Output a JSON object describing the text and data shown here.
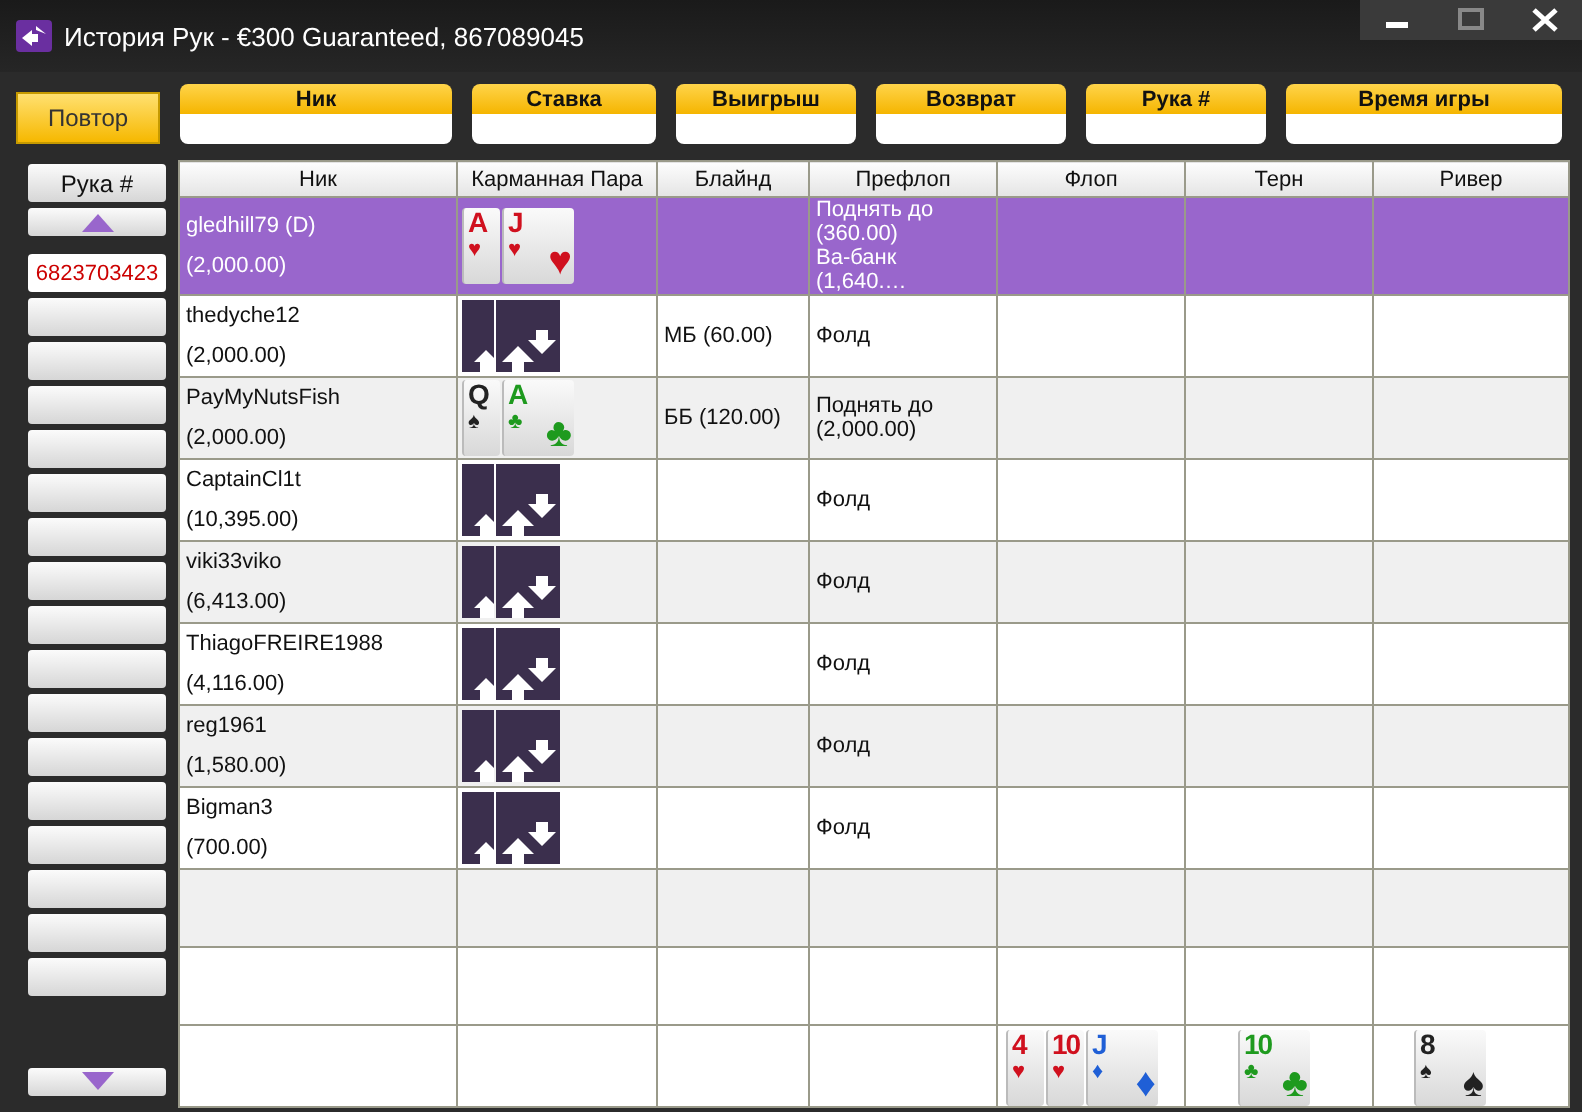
{
  "window": {
    "title": "История Рук - €300 Guaranteed, 867089045"
  },
  "replay_button": {
    "label": "Повтор"
  },
  "filters": [
    {
      "label": "Ник"
    },
    {
      "label": "Ставка"
    },
    {
      "label": "Выигрыш"
    },
    {
      "label": "Возврат"
    },
    {
      "label": "Рука #"
    },
    {
      "label": "Время игры"
    }
  ],
  "hand_list": {
    "header": "Рука #",
    "items": [
      {
        "number": "6823703423"
      }
    ]
  },
  "table": {
    "columns": [
      "Ник",
      "Карманная Пара",
      "Блайнд",
      "Префлоп",
      "Флоп",
      "Терн",
      "Ривер"
    ],
    "rows": [
      {
        "name": "gledhill79 (D)",
        "stack": "(2,000.00)",
        "selected": true,
        "cards": [
          {
            "kind": "face",
            "rank": "A",
            "corner_suit": "♥",
            "color": "#d0101e"
          },
          {
            "kind": "face",
            "rank": "J",
            "corner_suit": "♥",
            "center_suit": "♥",
            "color": "#d0101e"
          }
        ],
        "blind": "",
        "preflop": [
          "Поднять до",
          "(360.00)",
          "Ва-банк (1,640.…"
        ]
      },
      {
        "name": "thedyche12",
        "stack": "(2,000.00)",
        "selected": false,
        "cards": [
          {
            "kind": "back"
          },
          {
            "kind": "back"
          }
        ],
        "blind": "МБ (60.00)",
        "preflop": [
          "Фолд"
        ]
      },
      {
        "name": "PayMyNutsFish",
        "stack": "(2,000.00)",
        "selected": false,
        "cards": [
          {
            "kind": "face",
            "rank": "Q",
            "corner_suit": "♠",
            "color": "#222222"
          },
          {
            "kind": "face",
            "rank": "A",
            "corner_suit": "♣",
            "center_suit": "♣",
            "color": "#1e9a1e"
          }
        ],
        "blind": "ББ (120.00)",
        "preflop": [
          "Поднять до",
          "(2,000.00)"
        ]
      },
      {
        "name": "CaptainCl1t",
        "stack": "(10,395.00)",
        "selected": false,
        "cards": [
          {
            "kind": "back"
          },
          {
            "kind": "back"
          }
        ],
        "blind": "",
        "preflop": [
          "Фолд"
        ]
      },
      {
        "name": "viki33viko",
        "stack": "(6,413.00)",
        "selected": false,
        "cards": [
          {
            "kind": "back"
          },
          {
            "kind": "back"
          }
        ],
        "blind": "",
        "preflop": [
          "Фолд"
        ]
      },
      {
        "name": "ThiagoFREIRE1988",
        "stack": "(4,116.00)",
        "selected": false,
        "cards": [
          {
            "kind": "back"
          },
          {
            "kind": "back"
          }
        ],
        "blind": "",
        "preflop": [
          "Фолд"
        ]
      },
      {
        "name": "reg1961",
        "stack": "(1,580.00)",
        "selected": false,
        "cards": [
          {
            "kind": "back"
          },
          {
            "kind": "back"
          }
        ],
        "blind": "",
        "preflop": [
          "Фолд"
        ]
      },
      {
        "name": "Bigman3",
        "stack": "(700.00)",
        "selected": false,
        "cards": [
          {
            "kind": "back"
          },
          {
            "kind": "back"
          }
        ],
        "blind": "",
        "preflop": [
          "Фолд"
        ]
      }
    ],
    "board": {
      "flop": [
        {
          "kind": "face",
          "rank": "4",
          "corner_suit": "♥",
          "color": "#d0101e"
        },
        {
          "kind": "face",
          "rank": "10",
          "corner_suit": "♥",
          "color": "#d0101e"
        },
        {
          "kind": "face",
          "rank": "J",
          "corner_suit": "♦",
          "center_suit": "♦",
          "color": "#1f5fd6"
        }
      ],
      "turn": [
        {
          "kind": "face",
          "rank": "10",
          "corner_suit": "♣",
          "center_suit": "♣",
          "color": "#1e9a1e"
        }
      ],
      "river": [
        {
          "kind": "face",
          "rank": "8",
          "corner_suit": "♠",
          "center_suit": "♠",
          "color": "#222222"
        }
      ]
    }
  }
}
